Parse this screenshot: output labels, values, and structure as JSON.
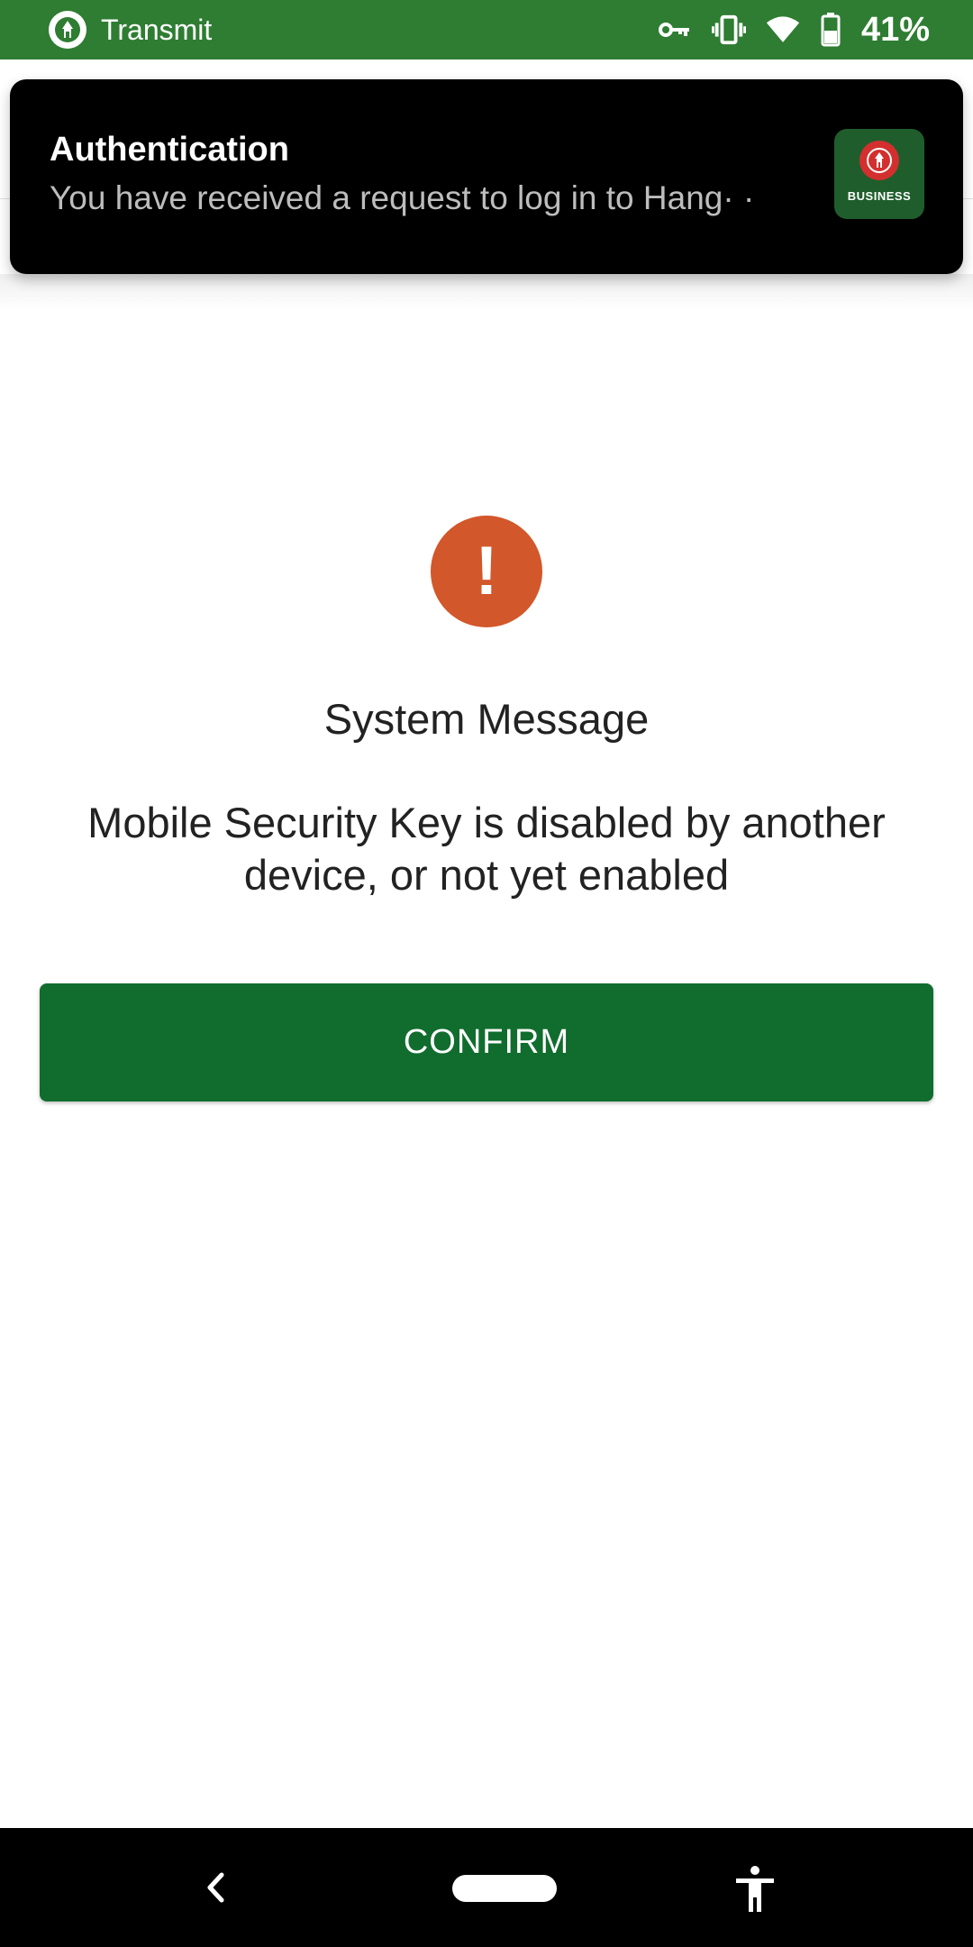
{
  "status_bar": {
    "app_name": "Transmit",
    "battery_percent": "41%",
    "icons": [
      "vpn-key-icon",
      "vibrate-icon",
      "wifi-icon",
      "battery-icon"
    ],
    "background_color": "#2e7d32"
  },
  "notification": {
    "title": "Authentication",
    "body": "You have received a request to log in to Hang· ·",
    "app_icon_label": "BUSINESS",
    "background_color": "#000000"
  },
  "message": {
    "icon": "exclamation-icon",
    "icon_glyph": "!",
    "icon_color": "#d2572a",
    "title": "System Message",
    "body": "Mobile Security Key is disabled by another device, or not yet enabled"
  },
  "confirm_button": {
    "label": "CONFIRM",
    "color": "#116d2e"
  },
  "nav_bar": {
    "icons": [
      "back-icon",
      "home-pill-icon",
      "accessibility-icon"
    ]
  }
}
